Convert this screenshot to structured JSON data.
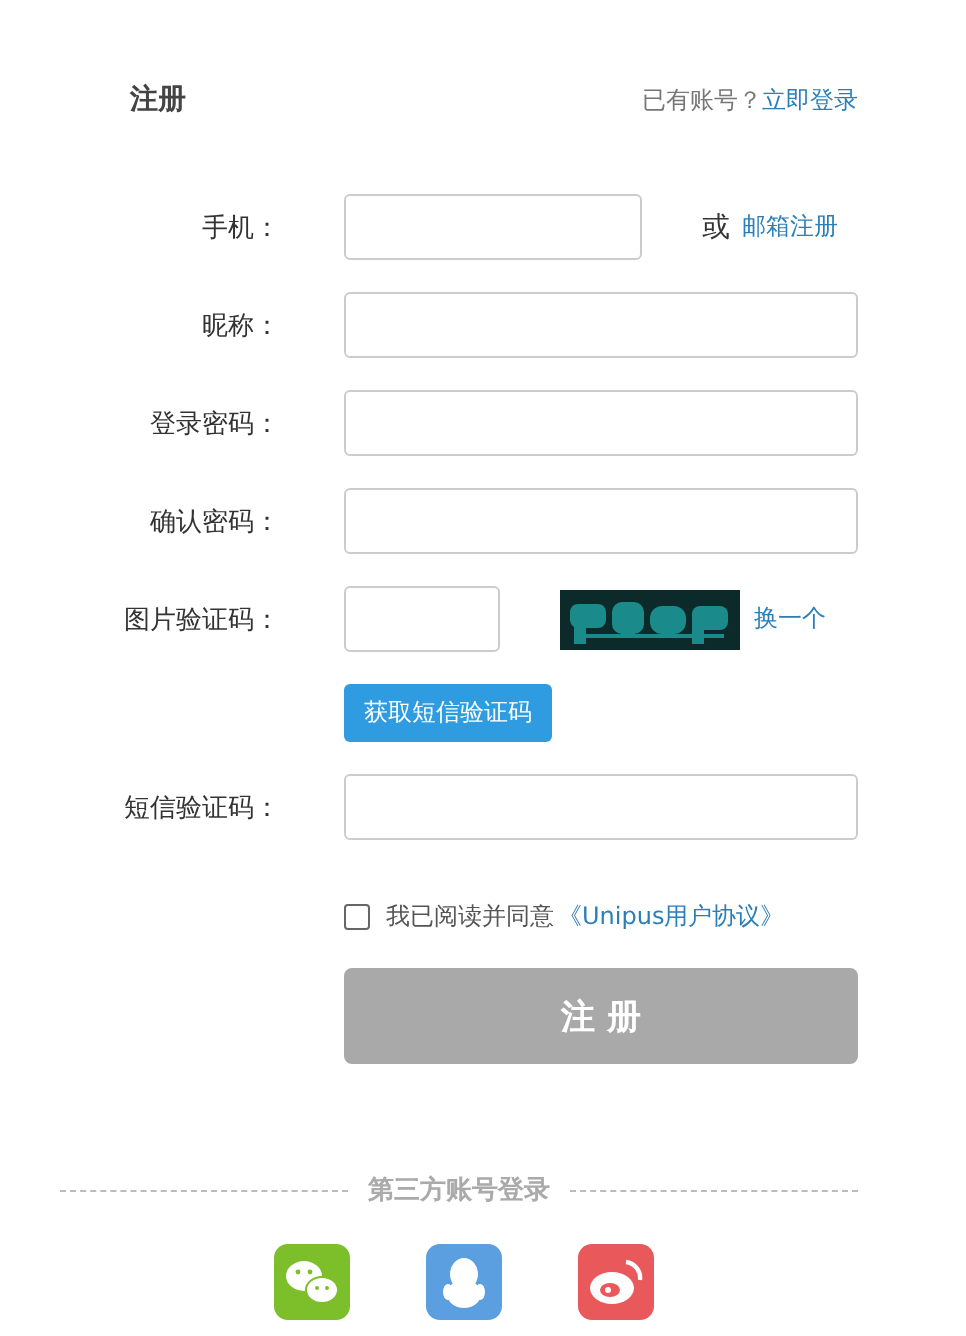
{
  "header": {
    "title": "注册",
    "login_prompt": "已有账号？",
    "login_link": "立即登录"
  },
  "fields": [
    {
      "kind": "phone",
      "label": "手机：",
      "or_text": "或",
      "alt_link": "邮箱注册"
    },
    {
      "kind": "text",
      "label": "昵称："
    },
    {
      "kind": "text",
      "label": "登录密码："
    },
    {
      "kind": "text",
      "label": "确认密码："
    },
    {
      "kind": "captcha",
      "label": "图片验证码：",
      "refresh_link": "换一个"
    },
    {
      "kind": "button",
      "label": "获取短信验证码"
    },
    {
      "kind": "text",
      "label": "短信验证码："
    }
  ],
  "agreement": {
    "checked": false,
    "text": "我已阅读并同意",
    "link": "《Unipus用户协议》"
  },
  "submit": {
    "label": "注 册",
    "disabled": true
  },
  "third_party": {
    "title": "第三方账号登录",
    "providers": [
      {
        "kind": "wechat",
        "color": "#7cbf2a"
      },
      {
        "kind": "qq",
        "color": "#5b9fe0"
      },
      {
        "kind": "weibo",
        "color": "#e9585a"
      }
    ]
  }
}
